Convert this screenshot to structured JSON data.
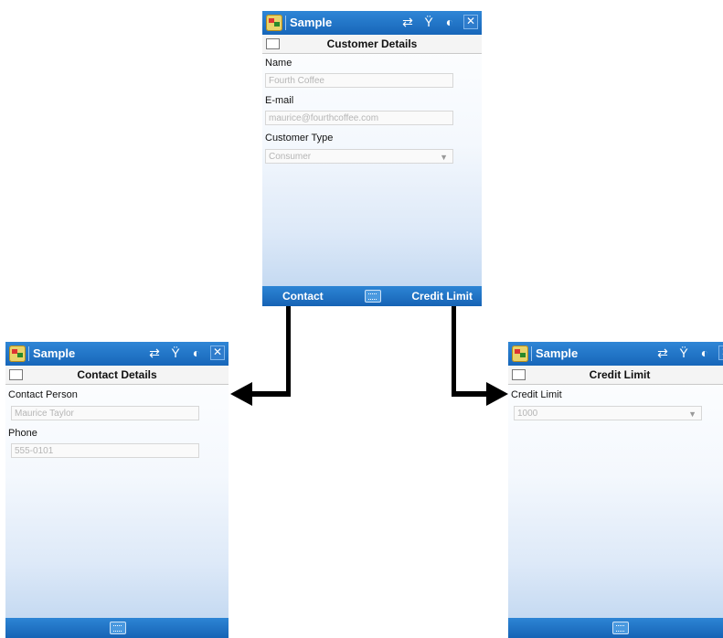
{
  "app": {
    "title": "Sample"
  },
  "screens": {
    "customer": {
      "header_title": "Customer Details",
      "fields": [
        {
          "label": "Name",
          "value": "Fourth Coffee"
        },
        {
          "label": "E-mail",
          "value": "maurice@fourthcoffee.com"
        },
        {
          "label": "Customer Type",
          "value": "Consumer"
        }
      ],
      "menu_left": "Contact",
      "menu_right": "Credit Limit"
    },
    "contact": {
      "header_title": "Contact Details",
      "fields": [
        {
          "label": "Contact Person",
          "value": "Maurice Taylor"
        },
        {
          "label": "Phone",
          "value": "555-0101"
        }
      ]
    },
    "credit": {
      "header_title": "Credit Limit",
      "fields": [
        {
          "label": "Credit Limit",
          "value": "1000"
        }
      ]
    }
  },
  "icons": {
    "start": "windows-start-icon",
    "sync": "sync-arrows-icon",
    "signal": "signal-icon",
    "volume": "volume-icon",
    "close": "close-icon",
    "keyboard": "keyboard-icon",
    "header": "form-icon"
  },
  "colors": {
    "titlebar": "#1f74c8",
    "menubar": "#1b6cc0",
    "field_text": "#b5b5b5"
  }
}
